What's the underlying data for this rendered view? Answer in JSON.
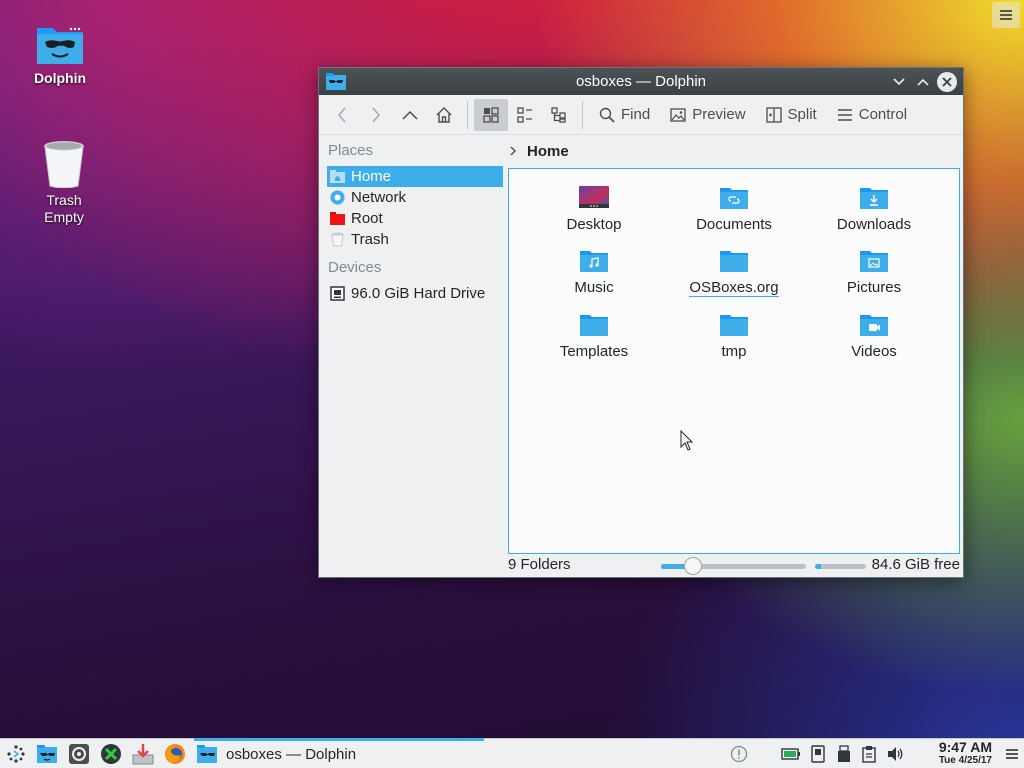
{
  "desktop": {
    "icons": [
      {
        "label": "Dolphin"
      },
      {
        "label": "Trash\nEmpty",
        "line1": "Trash",
        "line2": "Empty"
      }
    ]
  },
  "window": {
    "title": "osboxes — Dolphin",
    "toolbar": {
      "find_label": "Find",
      "preview_label": "Preview",
      "split_label": "Split",
      "control_label": "Control"
    },
    "places": {
      "header": "Places",
      "items": [
        {
          "label": "Home",
          "icon": "home-icon",
          "selected": true
        },
        {
          "label": "Network",
          "icon": "network-icon"
        },
        {
          "label": "Root",
          "icon": "root-folder-icon"
        },
        {
          "label": "Trash",
          "icon": "trash-icon"
        }
      ],
      "devices_header": "Devices",
      "devices": [
        {
          "label": "96.0 GiB Hard Drive",
          "icon": "hard-drive-icon"
        }
      ]
    },
    "breadcrumb": "Home",
    "folders": [
      {
        "label": "Desktop",
        "icon": "desktop-folder-icon"
      },
      {
        "label": "Documents",
        "icon": "documents-folder-icon"
      },
      {
        "label": "Downloads",
        "icon": "downloads-folder-icon"
      },
      {
        "label": "Music",
        "icon": "music-folder-icon"
      },
      {
        "label": "OSBoxes.org",
        "icon": "folder-icon"
      },
      {
        "label": "Pictures",
        "icon": "pictures-folder-icon"
      },
      {
        "label": "Templates",
        "icon": "templates-folder-icon"
      },
      {
        "label": "tmp",
        "icon": "folder-icon"
      },
      {
        "label": "Videos",
        "icon": "videos-folder-icon"
      }
    ],
    "statusbar": {
      "status": "9 Folders",
      "zoom_level": 0.18,
      "free_space": "84.6 GiB free",
      "used_fraction": 0.12
    }
  },
  "taskbar": {
    "task_label": "osboxes — Dolphin",
    "clock_time": "9:47 AM",
    "clock_date": "Tue 4/25/17"
  },
  "colors": {
    "accent": "#3daee9",
    "titlebar": "#3c4044",
    "folder": "#3daee9"
  }
}
